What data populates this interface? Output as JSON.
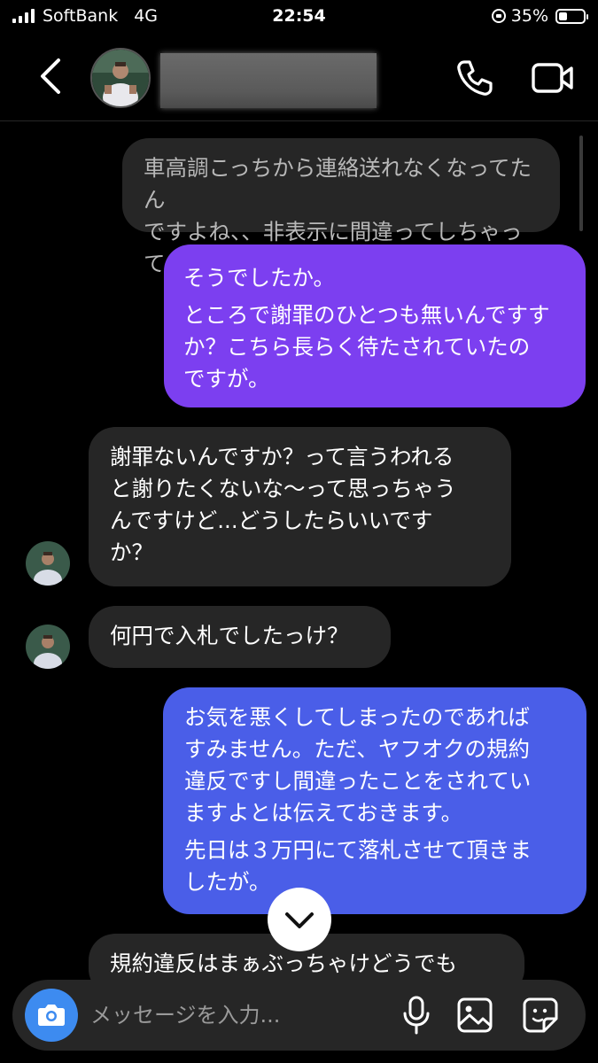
{
  "status_bar": {
    "carrier": "SoftBank",
    "network": "4G",
    "time": "22:54",
    "battery": "35%",
    "battery_level": 0.35
  },
  "header": {
    "back_icon": "chevron-left-icon",
    "call_icon": "phone-icon",
    "video_icon": "video-camera-icon"
  },
  "messages": [
    {
      "direction": "received",
      "lines": [
        "車高調こっちから連絡送れなくなってたん\nですよね、、非表示に間違ってしちゃって"
      ]
    },
    {
      "direction": "sent",
      "lines": [
        "そうでしたか。",
        "ところで謝罪のひとつも無いんですす\nか？こちら長らく待たされていたの\nですが。"
      ]
    },
    {
      "direction": "received",
      "lines": [
        "謝罪ないんですか？って言うわれる\nと謝りたくないな〜って思っちゃう\nんですけど...どうしたらいいです\nか？"
      ]
    },
    {
      "direction": "received",
      "lines": [
        "何円で入札でしたっけ？"
      ]
    },
    {
      "direction": "sent",
      "lines": [
        "お気を悪くしてしまったのであれば\nすみません。ただ、ヤフオクの規約\n違反ですし間違ったことをされてい\nますよとは伝えておきます。",
        "先日は３万円にて落札させて頂きま\nしたが。"
      ]
    },
    {
      "direction": "received",
      "lines": [
        "規約違反はまぁぶっちゃけどうでも"
      ]
    }
  ],
  "composer": {
    "placeholder": "メッセージを入力...",
    "camera_icon": "camera-icon",
    "mic_icon": "microphone-icon",
    "gallery_icon": "image-icon",
    "sticker_icon": "sticker-icon"
  },
  "colors": {
    "background": "#000000",
    "received_bubble": "#262626",
    "sent_bubble_top": "#7c3ff0",
    "sent_bubble_bottom": "#4a5ee8",
    "camera_button": "#3d8bf0"
  }
}
